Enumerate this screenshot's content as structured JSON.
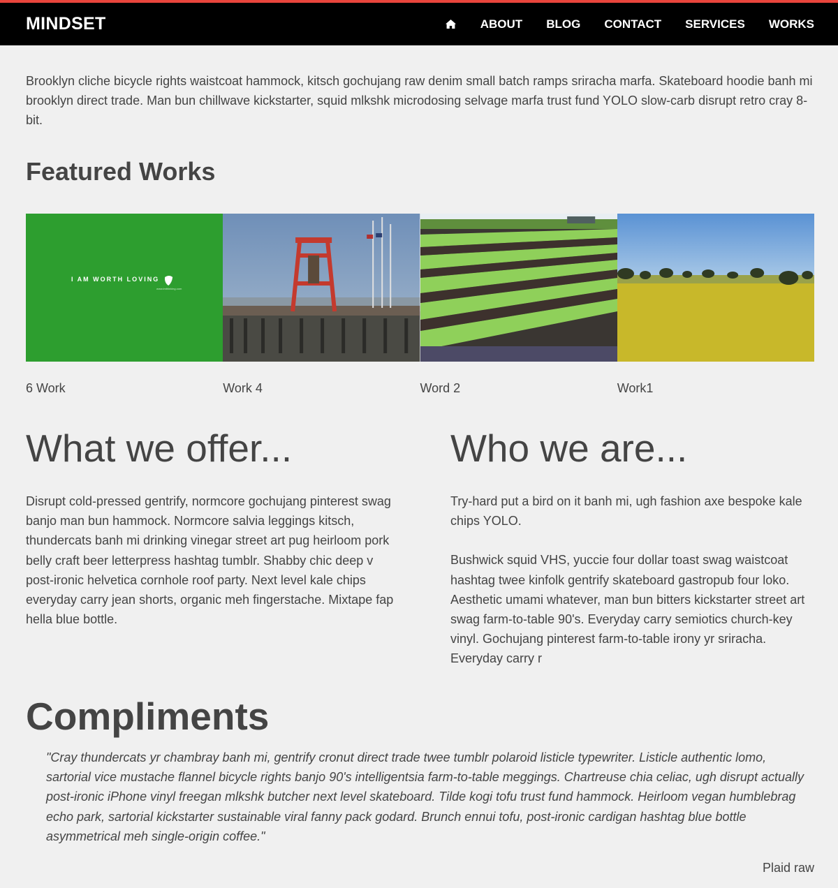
{
  "colors": {
    "accent_bar": "#e8453c",
    "navbar_bg": "#000000",
    "page_bg": "#f0f0f0",
    "text": "#444444"
  },
  "navbar": {
    "brand": "MINDSET",
    "home_icon": "home-icon",
    "items": [
      {
        "label": "ABOUT"
      },
      {
        "label": "BLOG"
      },
      {
        "label": "CONTACT"
      },
      {
        "label": "SERVICES"
      },
      {
        "label": "WORKS"
      }
    ]
  },
  "intro": "Brooklyn cliche bicycle rights waistcoat hammock, kitsch gochujang raw denim small batch ramps sriracha marfa. Skateboard hoodie banh mi brooklyn direct trade. Man bun chillwave kickstarter, squid mlkshk microdosing selvage marfa trust fund YOLO slow-carb disrupt retro cray 8-bit.",
  "featured": {
    "title": "Featured Works",
    "works": [
      {
        "caption": "6 Work",
        "image_text": "I AM WORTH LOVING",
        "image_subtext": "www.imthinking.com"
      },
      {
        "caption": "Work 4"
      },
      {
        "caption": "Word 2"
      },
      {
        "caption": "Work1"
      }
    ]
  },
  "offer": {
    "title": "What we offer...",
    "text": "Disrupt cold-pressed gentrify, normcore gochujang pinterest swag banjo man bun hammock. Normcore salvia leggings kitsch, thundercats banh mi drinking vinegar street art pug heirloom pork belly craft beer letterpress hashtag tumblr. Shabby chic deep v post-ironic helvetica cornhole roof party. Next level kale chips everyday carry jean shorts, organic meh fingerstache. Mixtape fap hella blue bottle."
  },
  "who": {
    "title": "Who we are...",
    "paragraphs": [
      "Try-hard put a bird on it banh mi, ugh fashion axe bespoke kale chips YOLO.",
      "Bushwick squid VHS, yuccie four dollar toast swag waistcoat hashtag twee kinfolk gentrify skateboard gastropub four loko. Aesthetic umami whatever, man bun bitters kickstarter street art swag farm-to-table 90's. Everyday carry semiotics church-key vinyl. Gochujang pinterest farm-to-table irony yr sriracha. Everyday carry r"
    ]
  },
  "compliments": {
    "title": "Compliments",
    "quote": "\"Cray thundercats yr chambray banh mi, gentrify cronut direct trade twee tumblr polaroid listicle typewriter. Listicle authentic lomo, sartorial vice mustache flannel bicycle rights banjo 90's intelligentsia farm-to-table meggings. Chartreuse chia celiac, ugh disrupt actually post-ironic iPhone vinyl freegan mlkshk butcher next level skateboard. Tilde kogi tofu trust fund hammock. Heirloom vegan humblebrag echo park, sartorial kickstarter sustainable viral fanny pack godard. Brunch ennui tofu, post-ironic cardigan hashtag blue bottle asymmetrical meh single-origin coffee.\"",
    "author": "Plaid raw"
  }
}
